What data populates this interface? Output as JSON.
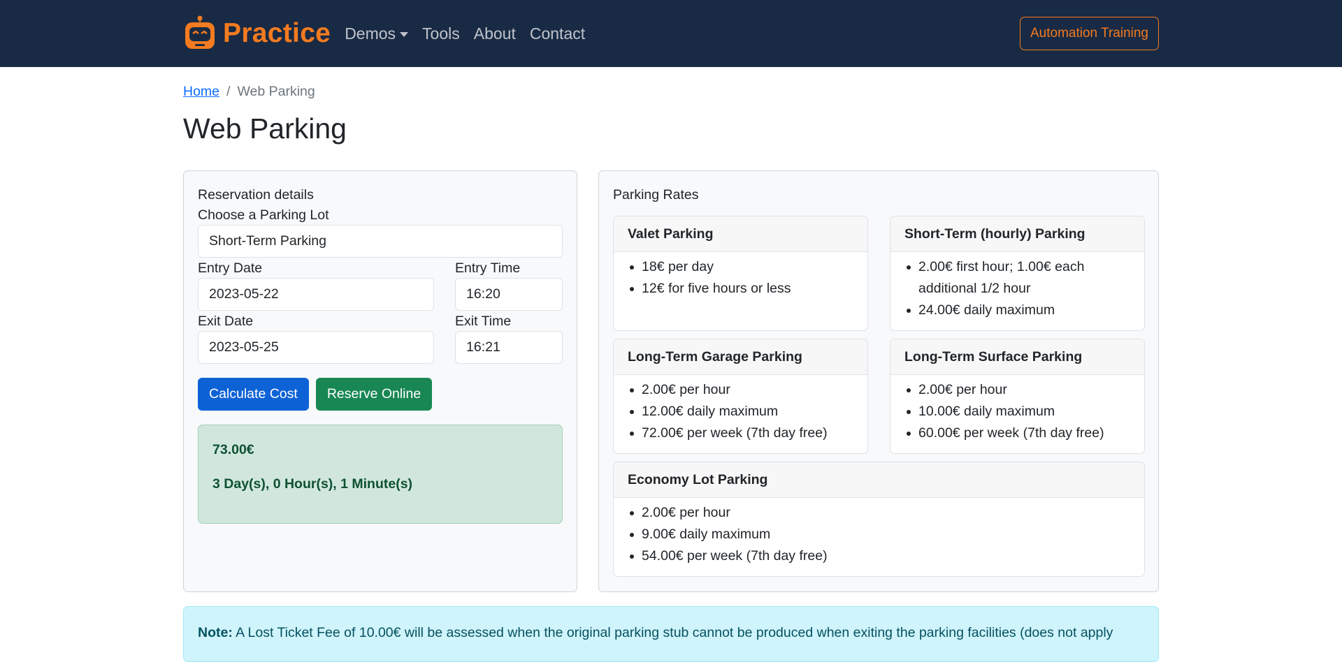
{
  "nav": {
    "brand": "Practice",
    "links": {
      "demos": "Demos",
      "tools": "Tools",
      "about": "About",
      "contact": "Contact"
    },
    "training": "Automation Training",
    "accent_color": "#f47b20",
    "bg_color": "#192a44"
  },
  "breadcrumb": {
    "home": "Home",
    "separator": "/",
    "current": "Web Parking"
  },
  "page_title": "Web Parking",
  "reservation": {
    "title": "Reservation details",
    "lot_label": "Choose a Parking Lot",
    "lot_value": "Short-Term Parking",
    "entry_date_label": "Entry Date",
    "entry_date": "2023-05-22",
    "entry_time_label": "Entry Time",
    "entry_time": "16:20",
    "exit_date_label": "Exit Date",
    "exit_date": "2023-05-25",
    "exit_time_label": "Exit Time",
    "exit_time": "16:21",
    "calculate_btn": "Calculate Cost",
    "reserve_btn": "Reserve Online",
    "result_cost": "73.00€",
    "result_duration": "3 Day(s), 0 Hour(s), 1 Minute(s)"
  },
  "rates": {
    "title": "Parking Rates",
    "cards": [
      {
        "name": "Valet Parking",
        "items": [
          "18€ per day",
          "12€ for five hours or less"
        ]
      },
      {
        "name": "Short-Term (hourly) Parking",
        "items": [
          "2.00€ first hour; 1.00€ each additional 1/2 hour",
          "24.00€ daily maximum"
        ]
      },
      {
        "name": "Long-Term Garage Parking",
        "items": [
          "2.00€ per hour",
          "12.00€ daily maximum",
          "72.00€ per week (7th day free)"
        ]
      },
      {
        "name": "Long-Term Surface Parking",
        "items": [
          "2.00€ per hour",
          "10.00€ daily maximum",
          "60.00€ per week (7th day free)"
        ]
      },
      {
        "name": "Economy Lot Parking",
        "items": [
          "2.00€ per hour",
          "9.00€ daily maximum",
          "54.00€ per week (7th day free)"
        ]
      }
    ]
  },
  "note": {
    "label": "Note:",
    "text": "A Lost Ticket Fee of 10.00€ will be assessed when the original parking stub cannot be produced when exiting the parking facilities (does not apply"
  }
}
